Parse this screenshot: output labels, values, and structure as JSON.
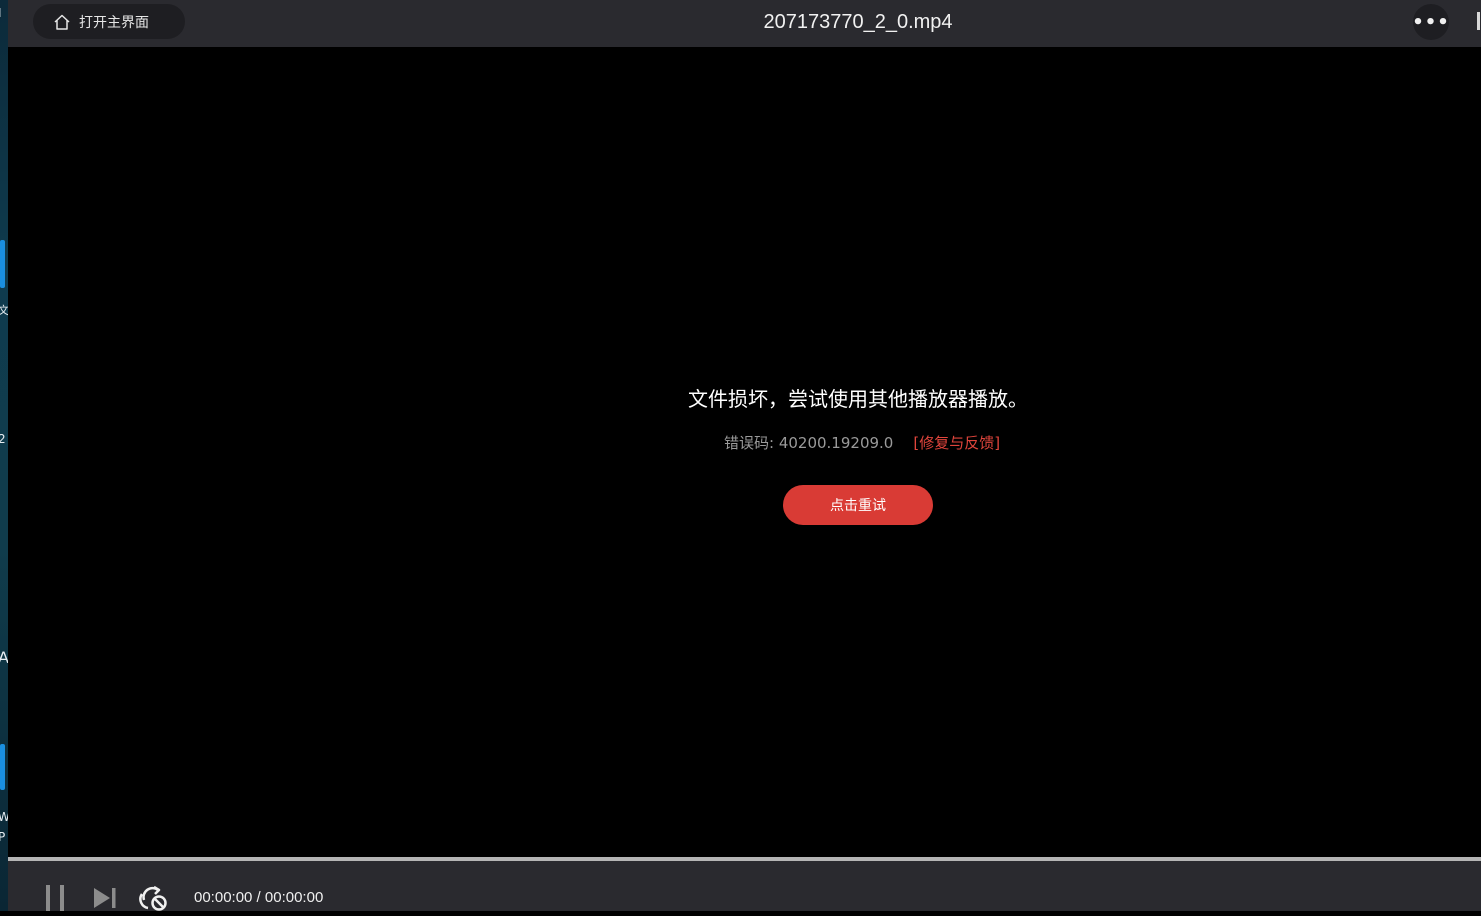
{
  "window": {
    "home_button_label": "打开主界面",
    "title": "207173770_2_0.mp4",
    "more_label": "•••"
  },
  "error": {
    "message": "文件损坏，尝试使用其他播放器播放。",
    "code": "错误码: 40200.19209.0",
    "feedback_link": "[修复与反馈]",
    "retry_button": "点击重试"
  },
  "controls": {
    "time_display": "00:00:00 / 00:00:00",
    "progress": 0
  },
  "desktop_strip": {
    "glyphs": [
      "I",
      "文",
      "2",
      "A",
      "W",
      "P"
    ]
  },
  "colors": {
    "accent_red": "#d93b35",
    "link_red": "#e0453c",
    "bar_bg": "#2a2a2f"
  }
}
